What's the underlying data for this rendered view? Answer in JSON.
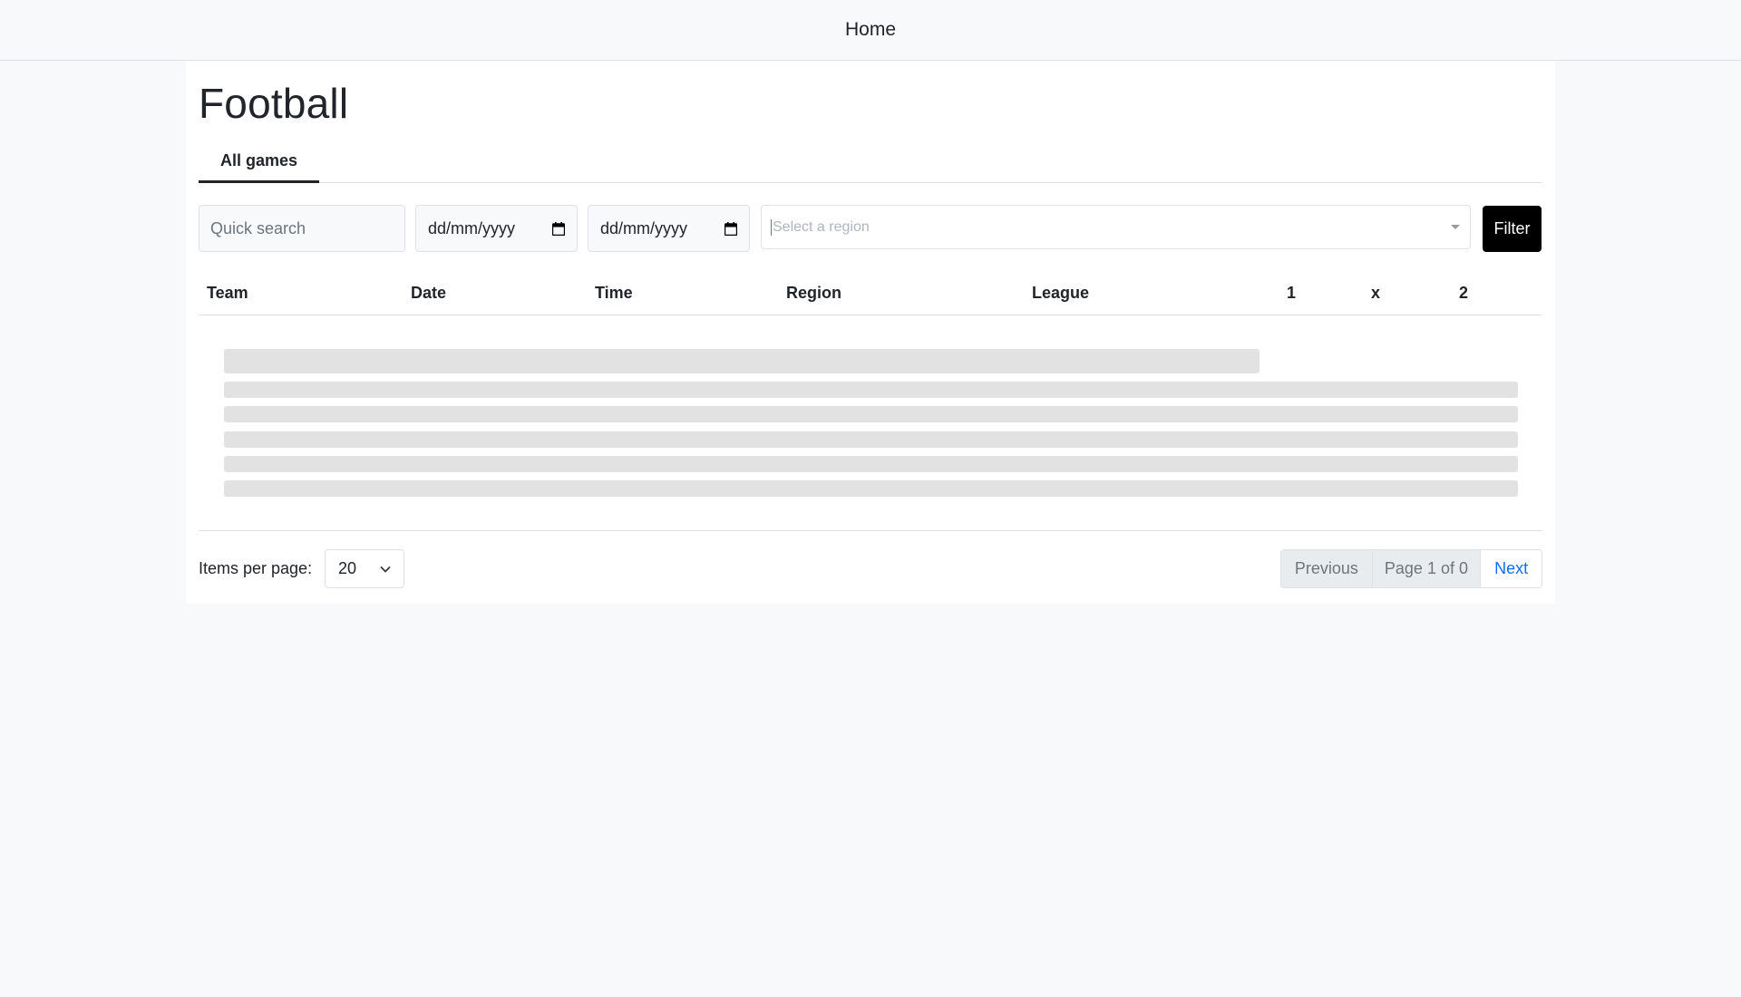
{
  "nav": {
    "home_label": "Home"
  },
  "page": {
    "title": "Football"
  },
  "tabs": [
    {
      "label": "All games"
    }
  ],
  "filters": {
    "search_placeholder": "Quick search",
    "date_from": "dd/mm/yyyy",
    "date_to": "dd/mm/yyyy",
    "region_placeholder": "Select a region",
    "filter_button": "Filter"
  },
  "table": {
    "columns": [
      "Team",
      "Date",
      "Time",
      "Region",
      "League",
      "1",
      "x",
      "2"
    ],
    "loading": true
  },
  "footer": {
    "items_per_page_label": "Items per page:",
    "items_per_page_value": "20",
    "previous": "Previous",
    "page_info": "Page 1 of 0",
    "next": "Next"
  }
}
